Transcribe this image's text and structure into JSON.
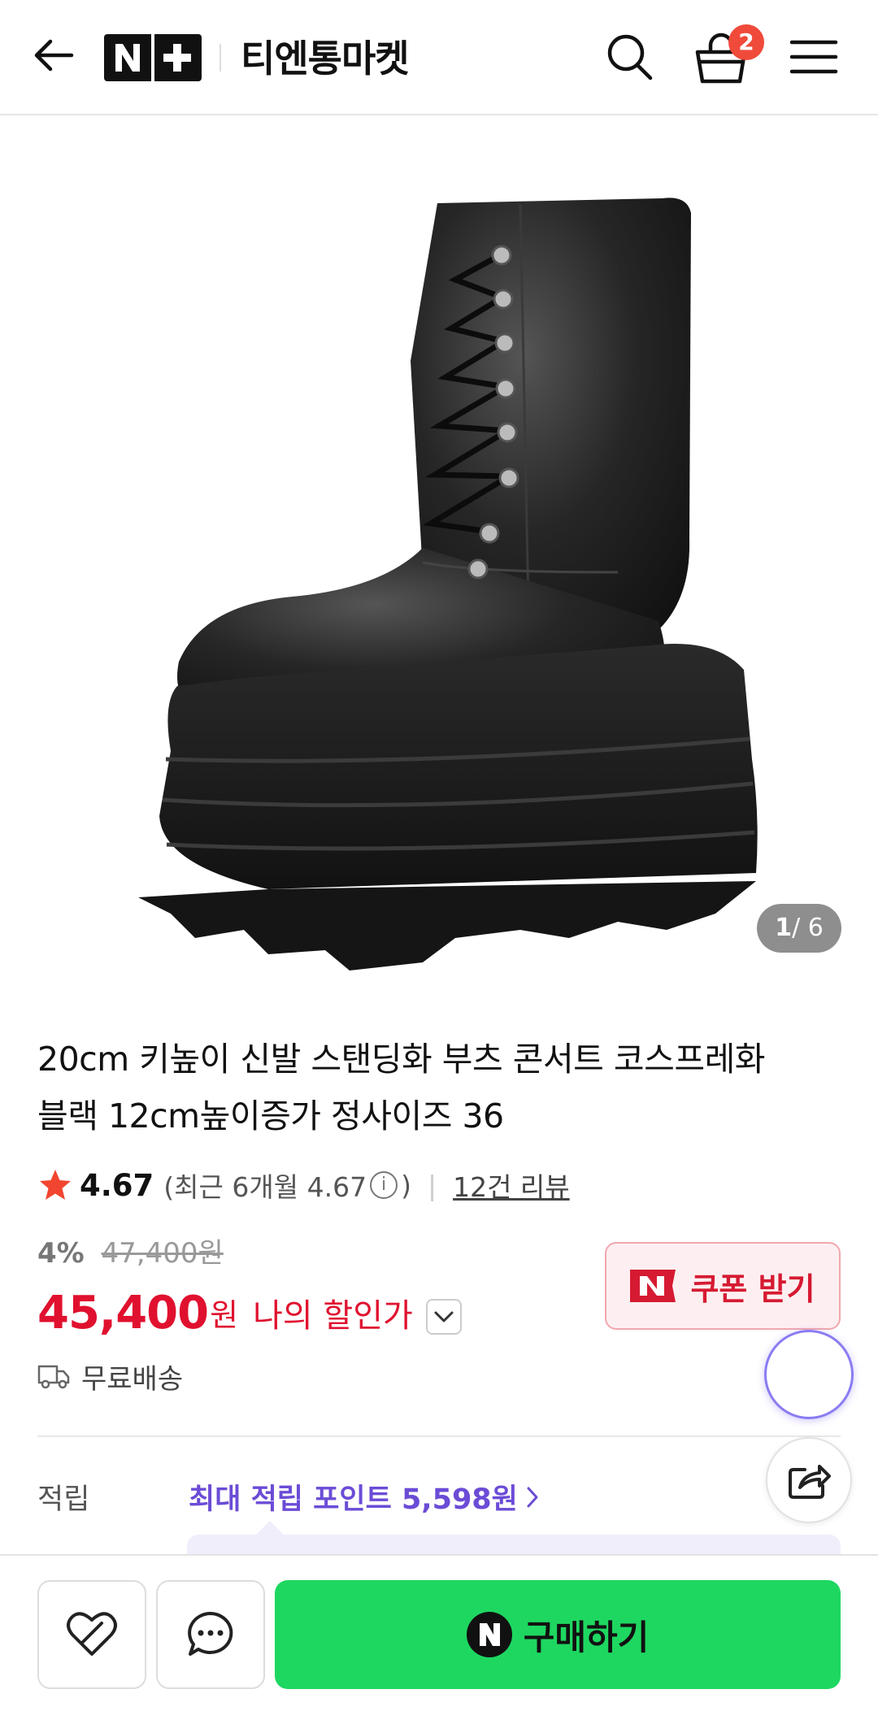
{
  "header": {
    "store_name": "티엔통마켓",
    "logo_text": "N+",
    "cart_count": "2"
  },
  "gallery": {
    "current": "1",
    "total": "/ 6"
  },
  "product": {
    "title_line1": "20cm 키높이 신발 스탠딩화 부츠 콘서트 코스프레화",
    "title_line2": "블랙 12cm높이증가 정사이즈 36",
    "rating": "4.67",
    "recent_rating_prefix": "(최근 6개월 4.67",
    "recent_rating_suffix": ")",
    "info_glyph": "i",
    "review_link": "12건 리뷰",
    "discount_rate": "4%",
    "original_price": "47,400원",
    "sale_price": "45,400",
    "won": "원",
    "my_price_label": "나의 할인가",
    "shipping": "무료배송"
  },
  "coupon": {
    "label": "쿠폰 받기"
  },
  "points": {
    "label": "적립",
    "value": "최대 적립 포인트 5,598원"
  },
  "bottom_bar": {
    "buy_label": "구매하기"
  },
  "colors": {
    "accent_red": "#e0112f",
    "buy_green": "#1ed760",
    "points_purple": "#6b4cd6",
    "badge_red": "#f04a3a"
  }
}
